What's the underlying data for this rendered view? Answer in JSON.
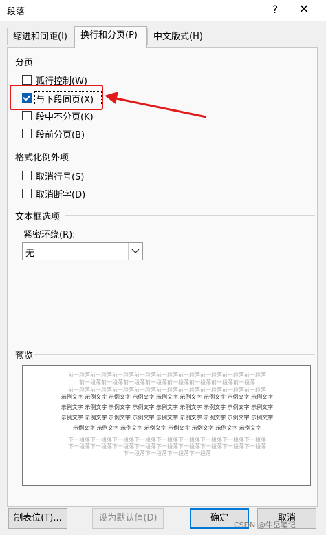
{
  "title": "段落",
  "titlebar": {
    "help_glyph": "?",
    "close_glyph": "✕"
  },
  "tabs": [
    {
      "label": "缩进和间距(I)",
      "active": false
    },
    {
      "label": "换行和分页(P)",
      "active": true
    },
    {
      "label": "中文版式(H)",
      "active": false
    }
  ],
  "pagination": {
    "label": "分页",
    "items": [
      {
        "label": "孤行控制(W)",
        "checked": false
      },
      {
        "label": "与下段同页(X)",
        "checked": true
      },
      {
        "label": "段中不分页(K)",
        "checked": false
      },
      {
        "label": "段前分页(B)",
        "checked": false
      }
    ]
  },
  "exceptions": {
    "label": "格式化例外项",
    "items": [
      {
        "label": "取消行号(S)",
        "checked": false
      },
      {
        "label": "取消断字(D)",
        "checked": false
      }
    ]
  },
  "textbox": {
    "label": "文本框选项",
    "wrap_label": "紧密环绕(R):",
    "wrap_value": "无"
  },
  "preview": {
    "label": "预览",
    "prev_lines": [
      "前一段落前一段落前一段落前一段落前一段落前一段落前一段落前一段落前一段落",
      "前一段落前一段落前一段落前一段落前一段落前一段落前一段落前一段落",
      "前一段落前一段落前一段落前一段落前一段落前一段落前一段落前一段落前一段落"
    ],
    "sample_lines": [
      "示例文字 示例文字 示例文字 示例文字 示例文字 示例文字 示例文字 示例文字 示例文字",
      "示例文字 示例文字 示例文字 示例文字 示例文字 示例文字 示例文字 示例文字 示例文字",
      "示例文字 示例文字 示例文字 示例文字 示例文字 示例文字 示例文字 示例文字 示例文字",
      "示例文字 示例文字 示例文字 示例文字 示例文字 示例文字 示例文字 示例文字"
    ],
    "next_lines": [
      "下一段落下一段落下一段落下一段落下一段落下一段落下一段落下一段落下一段落",
      "下一段落下一段落下一段落下一段落下一段落下一段落下一段落下一段落下一段落",
      "下一段落下一段落下一段落下一段落"
    ]
  },
  "buttons": {
    "tabs": "制表位(T)...",
    "set_default": "设为默认值(D)",
    "ok": "确定",
    "cancel": "取消"
  },
  "watermark": "CSDN @牛岳笔记",
  "colors": {
    "accent": "#0a5fb4",
    "annotation": "#e21a1a"
  }
}
